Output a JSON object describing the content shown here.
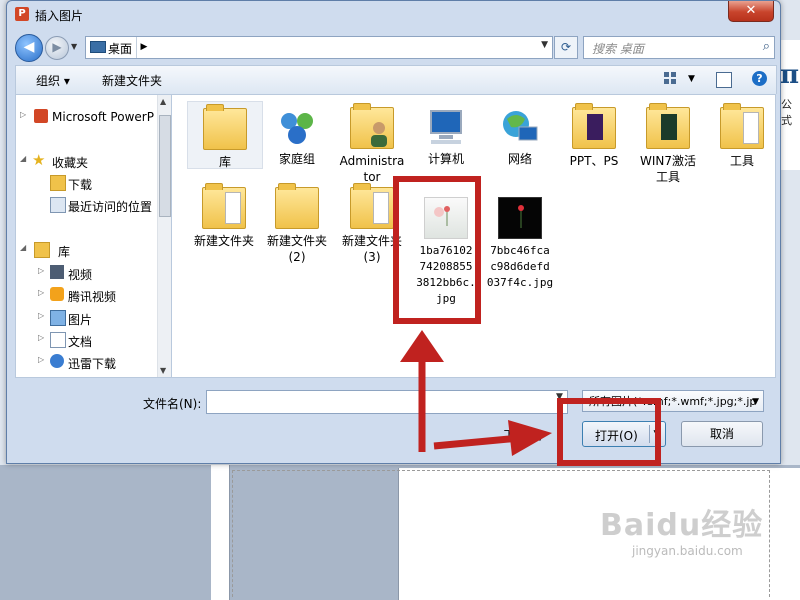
{
  "dialog": {
    "title": "插入图片",
    "close_label": "✕"
  },
  "address": {
    "location": "桌面",
    "search_placeholder": "搜索 桌面"
  },
  "toolbar": {
    "organize": "组织 ▾",
    "new_folder": "新建文件夹"
  },
  "nav": {
    "items": [
      {
        "label": "Microsoft PowerP",
        "icon": "powerpoint-icon"
      },
      {
        "label": "收藏夹",
        "icon": "star-icon"
      },
      {
        "label": "下载",
        "icon": "download-folder-icon"
      },
      {
        "label": "最近访问的位置",
        "icon": "recent-places-icon"
      },
      {
        "label": "库",
        "icon": "library-icon"
      },
      {
        "label": "视频",
        "icon": "video-icon"
      },
      {
        "label": "腾讯视频",
        "icon": "tencent-video-icon"
      },
      {
        "label": "图片",
        "icon": "pictures-icon"
      },
      {
        "label": "文档",
        "icon": "documents-icon"
      },
      {
        "label": "迅雷下载",
        "icon": "thunder-icon"
      }
    ]
  },
  "files": [
    {
      "label": "库",
      "icon": "library-folder-icon"
    },
    {
      "label": "家庭组",
      "icon": "homegroup-icon"
    },
    {
      "label": "Administra\ntor",
      "icon": "user-folder-icon"
    },
    {
      "label": "计算机",
      "icon": "computer-icon"
    },
    {
      "label": "网络",
      "icon": "network-icon"
    },
    {
      "label": "PPT、PS",
      "icon": "folder-icon"
    },
    {
      "label": "WIN7激活\n工具",
      "icon": "folder-icon"
    },
    {
      "label": "工具",
      "icon": "folder-icon"
    },
    {
      "label": "新建文件夹",
      "icon": "folder-icon"
    },
    {
      "label": "新建文件夹\n(2)",
      "icon": "folder-icon"
    },
    {
      "label": "新建文件夹\n(3)",
      "icon": "folder-icon"
    },
    {
      "label": "1ba76102\n74208855\n3812bb6c.\njpg",
      "icon": "image-file-icon"
    },
    {
      "label": "7bbc46fca\nc98d6defd\n037f4c.jpg",
      "icon": "image-file-icon"
    }
  ],
  "bottom": {
    "filename_label": "文件名(N):",
    "filename_value": "",
    "filetype_value": "所有图片(*.emf;*.wmf;*.jpg;*.jp",
    "tools_label": "工具(L)",
    "open_label": "打开(O)",
    "cancel_label": "取消"
  },
  "background": {
    "pi_symbol": "π",
    "formula_label": "公式",
    "watermark_main": "Baidu经验",
    "watermark_sub": "jingyan.baidu.com"
  },
  "colors": {
    "highlight": "#c0221f",
    "window_frame": "#cfdcee"
  }
}
